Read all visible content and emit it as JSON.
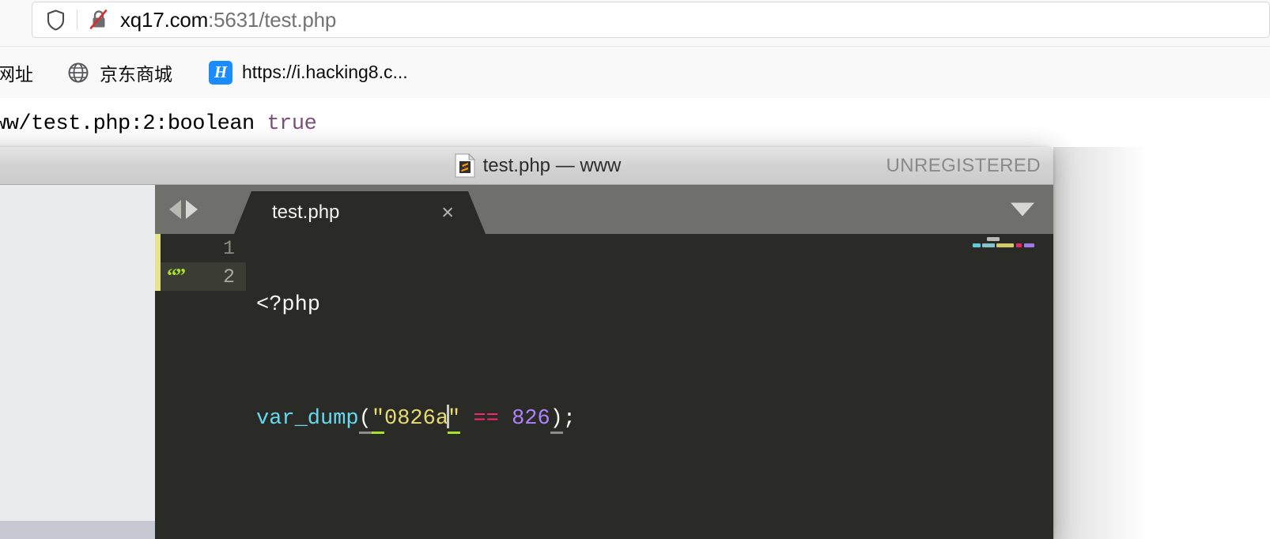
{
  "browser": {
    "urlbar": {
      "shield_icon": "shield-icon",
      "security_icon": "lock-broken-icon",
      "host": "xq17.com",
      "path": ":5631/test.php",
      "full_url": "xq17.com:5631/test.php"
    },
    "bookmarks": [
      {
        "icon": "none",
        "label": "网址"
      },
      {
        "icon": "globe-icon",
        "label": "京东商城"
      },
      {
        "icon": "hacking8-favicon",
        "label": "https://i.hacking8.c..."
      }
    ]
  },
  "page": {
    "vardump_prefix": "ww/test.php:2:boolean",
    "vardump_value": "true"
  },
  "sublime": {
    "titlebar": {
      "doc_icon": "sublime-document-icon",
      "title": "test.php — www",
      "license_status": "UNREGISTERED"
    },
    "tabbar": {
      "prev_icon": "triangle-left-icon",
      "next_icon": "triangle-right-icon",
      "dropdown_icon": "chevron-down-icon",
      "tabs": [
        {
          "label": "test.php",
          "close_icon": "×",
          "active": true
        }
      ]
    },
    "editor": {
      "lines": [
        {
          "number": "1",
          "gutter_mark": "",
          "active": false
        },
        {
          "number": "2",
          "gutter_mark": "“”",
          "active": true
        }
      ],
      "line1": {
        "php_open": "<?php"
      },
      "line2": {
        "fn": "var_dump",
        "open_paren": "(",
        "string": "\"0826a\"",
        "string_open_quote": "\"",
        "string_body": "0826a",
        "string_close_quote": "\"",
        "operator": "==",
        "number": "826",
        "close_paren": ")",
        "semicolon": ";"
      }
    },
    "colors": {
      "background": "#2a2b26",
      "function": "#66d9ef",
      "string": "#e6db74",
      "operator": "#f92672",
      "number": "#ae81ff",
      "plain": "#f8f8f2",
      "gutter_mark": "#a6e22e",
      "caret_strip": "#e7e38c",
      "tabbar": "#6f6f6b"
    }
  }
}
